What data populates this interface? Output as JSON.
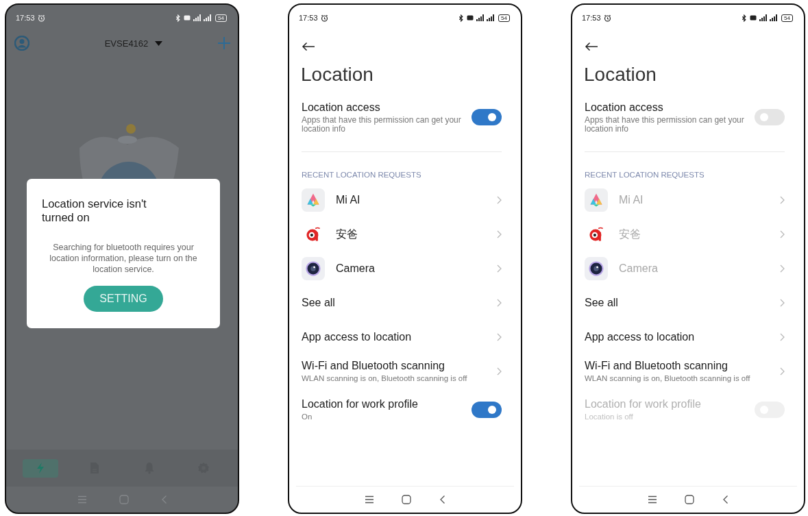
{
  "phones": [
    {
      "kind": "app_dialog",
      "status_bar": {
        "time": "17:53",
        "battery": "54"
      },
      "header": {
        "device": "EVSE4162"
      },
      "dialog": {
        "title": "Location service isn't turned on",
        "message": "Searching for bluetooth requires your location information, please turn on the location service.",
        "button": "SETTING"
      },
      "bottom_tabs": [
        {
          "kind": "charge",
          "selected": true
        },
        {
          "kind": "records",
          "selected": false
        },
        {
          "kind": "alerts",
          "selected": false
        },
        {
          "kind": "settings",
          "selected": false
        }
      ]
    },
    {
      "kind": "settings",
      "status_bar": {
        "time": "17:53",
        "battery": "54"
      },
      "title": "Location",
      "location_access": {
        "label": "Location access",
        "description": "Apps that have this permission can get your location info",
        "on": true
      },
      "section_header": "RECENT LOCATION REQUESTS",
      "recent_apps": [
        {
          "kind": "assistant",
          "name": "Mi AI",
          "disabled": false
        },
        {
          "kind": "tracker",
          "name": "安爸",
          "disabled": false
        },
        {
          "kind": "camera",
          "name": "Camera",
          "disabled": false
        }
      ],
      "items": [
        {
          "label": "See all"
        },
        {
          "label": "App access to location"
        },
        {
          "label": "Wi-Fi and Bluetooth scanning",
          "description": "WLAN scanning is on, Bluetooth scanning is off"
        }
      ],
      "work_profile": {
        "label": "Location for work profile",
        "description": "On",
        "on": true,
        "disabled": false
      }
    },
    {
      "kind": "settings",
      "status_bar": {
        "time": "17:53",
        "battery": "54"
      },
      "title": "Location",
      "location_access": {
        "label": "Location access",
        "description": "Apps that have this permission can get your location info",
        "on": false
      },
      "section_header": "RECENT LOCATION REQUESTS",
      "recent_apps": [
        {
          "kind": "assistant",
          "name": "Mi AI",
          "disabled": true
        },
        {
          "kind": "tracker",
          "name": "安爸",
          "disabled": true
        },
        {
          "kind": "camera",
          "name": "Camera",
          "disabled": true
        }
      ],
      "items": [
        {
          "label": "See all"
        },
        {
          "label": "App access to location"
        },
        {
          "label": "Wi-Fi and Bluetooth scanning",
          "description": "WLAN scanning is on, Bluetooth scanning is off"
        }
      ],
      "work_profile": {
        "label": "Location for work profile",
        "description": "Location is off",
        "on": false,
        "disabled": true
      }
    }
  ]
}
